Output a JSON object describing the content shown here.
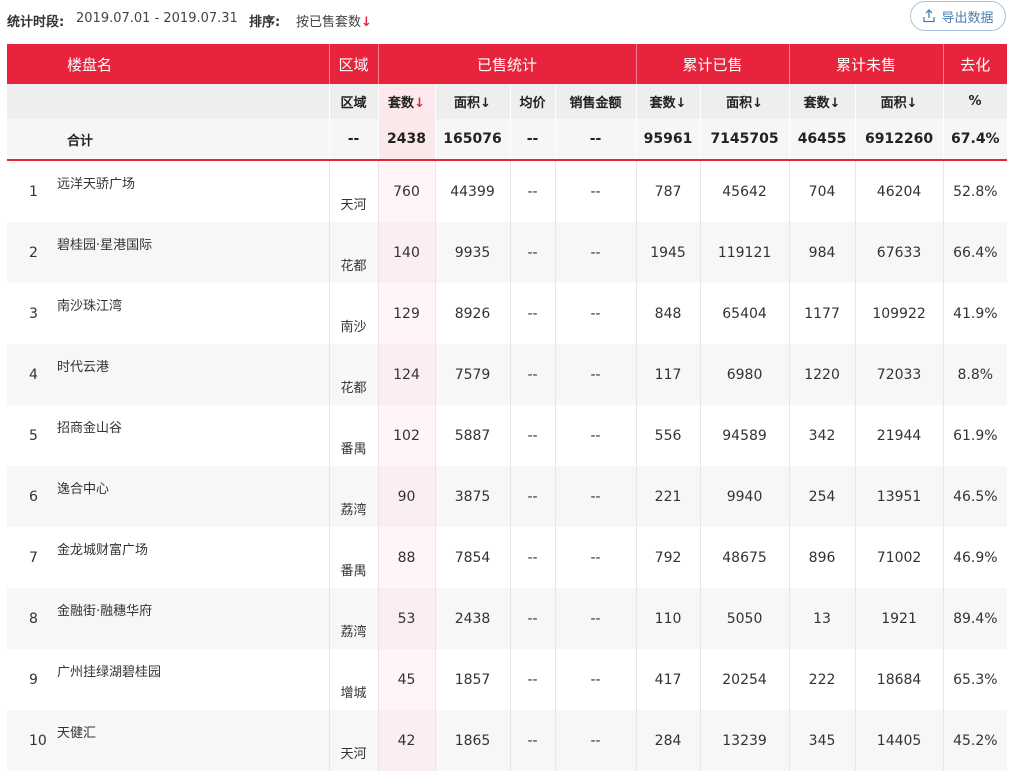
{
  "filter": {
    "period_label": "统计时段:",
    "period_value": "2019.07.01 - 2019.07.31",
    "sort_label": "排序:",
    "sort_value": "按已售套数",
    "sort_arrow": "↓"
  },
  "export_button": {
    "label": "导出数据",
    "icon": "upload-icon"
  },
  "header_groups": {
    "name": "楼盘名",
    "area": "区域",
    "sold": "已售统计",
    "cumulative_sold": "累计已售",
    "cumulative_unsold": "累计未售",
    "absorption": "去化"
  },
  "sub_headers": {
    "area": "区域",
    "sold_units": "套数",
    "sold_area": "面积",
    "avg_price": "均价",
    "sales_amount": "销售金额",
    "cum_sold_units": "套数",
    "cum_sold_area": "面积",
    "cum_unsold_units": "套数",
    "cum_unsold_area": "面积",
    "absorption_pct": "%",
    "arrow_red": "↓",
    "arrow": "↓"
  },
  "total": {
    "label": "合计",
    "area": "--",
    "sold_units": "2438",
    "sold_area": "165076",
    "avg_price": "--",
    "sales_amount": "--",
    "cum_sold_units": "95961",
    "cum_sold_area": "7145705",
    "cum_unsold_units": "46455",
    "cum_unsold_area": "6912260",
    "absorption": "67.4%"
  },
  "rows": [
    {
      "rank": "1",
      "name": "远洋天骄广场",
      "area": "天河",
      "sold_units": "760",
      "sold_area": "44399",
      "avg_price": "--",
      "sales_amount": "--",
      "cum_sold_units": "787",
      "cum_sold_area": "45642",
      "cum_unsold_units": "704",
      "cum_unsold_area": "46204",
      "absorption": "52.8%"
    },
    {
      "rank": "2",
      "name": "碧桂园·星港国际",
      "area": "花都",
      "sold_units": "140",
      "sold_area": "9935",
      "avg_price": "--",
      "sales_amount": "--",
      "cum_sold_units": "1945",
      "cum_sold_area": "119121",
      "cum_unsold_units": "984",
      "cum_unsold_area": "67633",
      "absorption": "66.4%"
    },
    {
      "rank": "3",
      "name": "南沙珠江湾",
      "area": "南沙",
      "sold_units": "129",
      "sold_area": "8926",
      "avg_price": "--",
      "sales_amount": "--",
      "cum_sold_units": "848",
      "cum_sold_area": "65404",
      "cum_unsold_units": "1177",
      "cum_unsold_area": "109922",
      "absorption": "41.9%"
    },
    {
      "rank": "4",
      "name": "时代云港",
      "area": "花都",
      "sold_units": "124",
      "sold_area": "7579",
      "avg_price": "--",
      "sales_amount": "--",
      "cum_sold_units": "117",
      "cum_sold_area": "6980",
      "cum_unsold_units": "1220",
      "cum_unsold_area": "72033",
      "absorption": "8.8%"
    },
    {
      "rank": "5",
      "name": "招商金山谷",
      "area": "番禺",
      "sold_units": "102",
      "sold_area": "5887",
      "avg_price": "--",
      "sales_amount": "--",
      "cum_sold_units": "556",
      "cum_sold_area": "94589",
      "cum_unsold_units": "342",
      "cum_unsold_area": "21944",
      "absorption": "61.9%"
    },
    {
      "rank": "6",
      "name": "逸合中心",
      "area": "荔湾",
      "sold_units": "90",
      "sold_area": "3875",
      "avg_price": "--",
      "sales_amount": "--",
      "cum_sold_units": "221",
      "cum_sold_area": "9940",
      "cum_unsold_units": "254",
      "cum_unsold_area": "13951",
      "absorption": "46.5%"
    },
    {
      "rank": "7",
      "name": "金龙城财富广场",
      "area": "番禺",
      "sold_units": "88",
      "sold_area": "7854",
      "avg_price": "--",
      "sales_amount": "--",
      "cum_sold_units": "792",
      "cum_sold_area": "48675",
      "cum_unsold_units": "896",
      "cum_unsold_area": "71002",
      "absorption": "46.9%"
    },
    {
      "rank": "8",
      "name": "金融街·融穗华府",
      "area": "荔湾",
      "sold_units": "53",
      "sold_area": "2438",
      "avg_price": "--",
      "sales_amount": "--",
      "cum_sold_units": "110",
      "cum_sold_area": "5050",
      "cum_unsold_units": "13",
      "cum_unsold_area": "1921",
      "absorption": "89.4%"
    },
    {
      "rank": "9",
      "name": "广州挂绿湖碧桂园",
      "area": "增城",
      "sold_units": "45",
      "sold_area": "1857",
      "avg_price": "--",
      "sales_amount": "--",
      "cum_sold_units": "417",
      "cum_sold_area": "20254",
      "cum_unsold_units": "222",
      "cum_unsold_area": "18684",
      "absorption": "65.3%"
    },
    {
      "rank": "10",
      "name": "天健汇",
      "area": "天河",
      "sold_units": "42",
      "sold_area": "1865",
      "avg_price": "--",
      "sales_amount": "--",
      "cum_sold_units": "284",
      "cum_sold_area": "13239",
      "cum_unsold_units": "345",
      "cum_unsold_area": "14405",
      "absorption": "45.2%"
    }
  ],
  "colors": {
    "accent": "#e8243c",
    "export": "#4a7fb0"
  }
}
